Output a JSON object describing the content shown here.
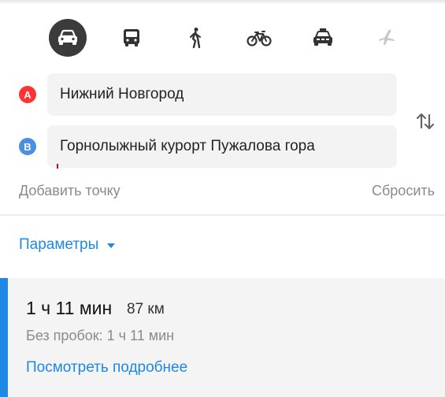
{
  "transport_modes": [
    {
      "id": "car",
      "icon": "car-icon",
      "active": true
    },
    {
      "id": "bus",
      "icon": "bus-icon",
      "active": false
    },
    {
      "id": "walk",
      "icon": "walking-person-icon",
      "active": false
    },
    {
      "id": "bike",
      "icon": "bicycle-icon",
      "active": false
    },
    {
      "id": "taxi",
      "icon": "taxi-icon",
      "active": false
    },
    {
      "id": "plane",
      "icon": "airplane-icon",
      "active": false,
      "disabled": true
    }
  ],
  "route": {
    "point_a": {
      "badge": "A",
      "value": "Нижний Новгород",
      "color": "#ff3333"
    },
    "point_b": {
      "badge": "B",
      "value": "Горнолыжный курорт Пужалова гора",
      "color": "#4a90e2"
    }
  },
  "actions": {
    "add_point": "Добавить точку",
    "reset": "Сбросить"
  },
  "params": {
    "label": "Параметры"
  },
  "result": {
    "duration": "1 ч 11 мин",
    "distance": "87 км",
    "no_traffic": "Без пробок: 1 ч 11 мин",
    "details_link": "Посмотреть подробнее"
  },
  "colors": {
    "accent": "#1e88e5",
    "active_mode_bg": "#3b3b3b",
    "muted_text": "#8a8a8a"
  }
}
